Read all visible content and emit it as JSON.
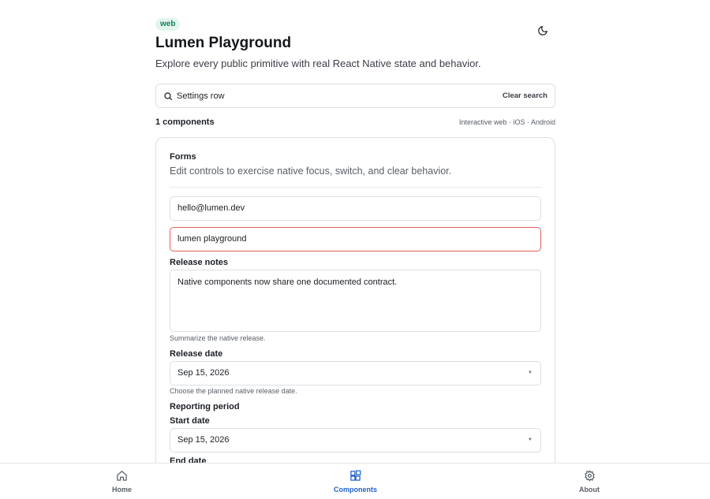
{
  "header": {
    "badge": "web",
    "title": "Lumen Playground",
    "subtitle": "Explore every public primitive with real React Native state and behavior.",
    "theme_toggle_icon": "moon-icon"
  },
  "search": {
    "value": "Settings row",
    "clear_label": "Clear search"
  },
  "results": {
    "count_label": "1 components",
    "platforms": "Interactive web · iOS · Android"
  },
  "card": {
    "title": "Forms",
    "description": "Edit controls to exercise native focus, switch, and clear behavior.",
    "fields": {
      "email_value": "hello@lumen.dev",
      "name_value": "lumen playground",
      "release_notes_label": "Release notes",
      "release_notes_value": "Native components now share one documented contract.",
      "release_notes_helper": "Summarize the native release.",
      "release_date_label": "Release date",
      "release_date_value": "Sep 15, 2026",
      "release_date_helper": "Choose the planned native release date.",
      "reporting_period_label": "Reporting period",
      "start_date_label": "Start date",
      "start_date_value": "Sep 15, 2026",
      "end_date_label": "End date"
    }
  },
  "tabs": [
    {
      "label": "Home",
      "icon": "home-icon",
      "active": false
    },
    {
      "label": "Components",
      "icon": "components-icon",
      "active": true
    },
    {
      "label": "About",
      "icon": "gear-icon",
      "active": false
    }
  ],
  "colors": {
    "accent": "#2563c9",
    "badge_bg": "#e3f6ee",
    "badge_text": "#12805c",
    "error_border": "#e0605e"
  }
}
